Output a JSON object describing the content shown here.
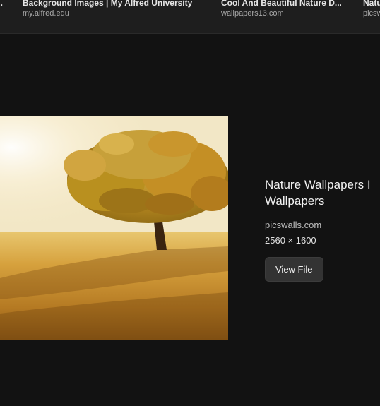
{
  "results": [
    {
      "title": "...",
      "source": ""
    },
    {
      "title": "Background Images | My Alfred University",
      "source": "my.alfred.edu"
    },
    {
      "title": "Cool And Beautiful Nature D...",
      "source": "wallpapers13.com"
    },
    {
      "title": "Natu",
      "source": "picsw"
    }
  ],
  "preview": {
    "title": "Nature Wallpapers I Wallpapers",
    "source": "picswalls.com",
    "dimensions": "2560 × 1600",
    "view_file_label": "View File"
  }
}
